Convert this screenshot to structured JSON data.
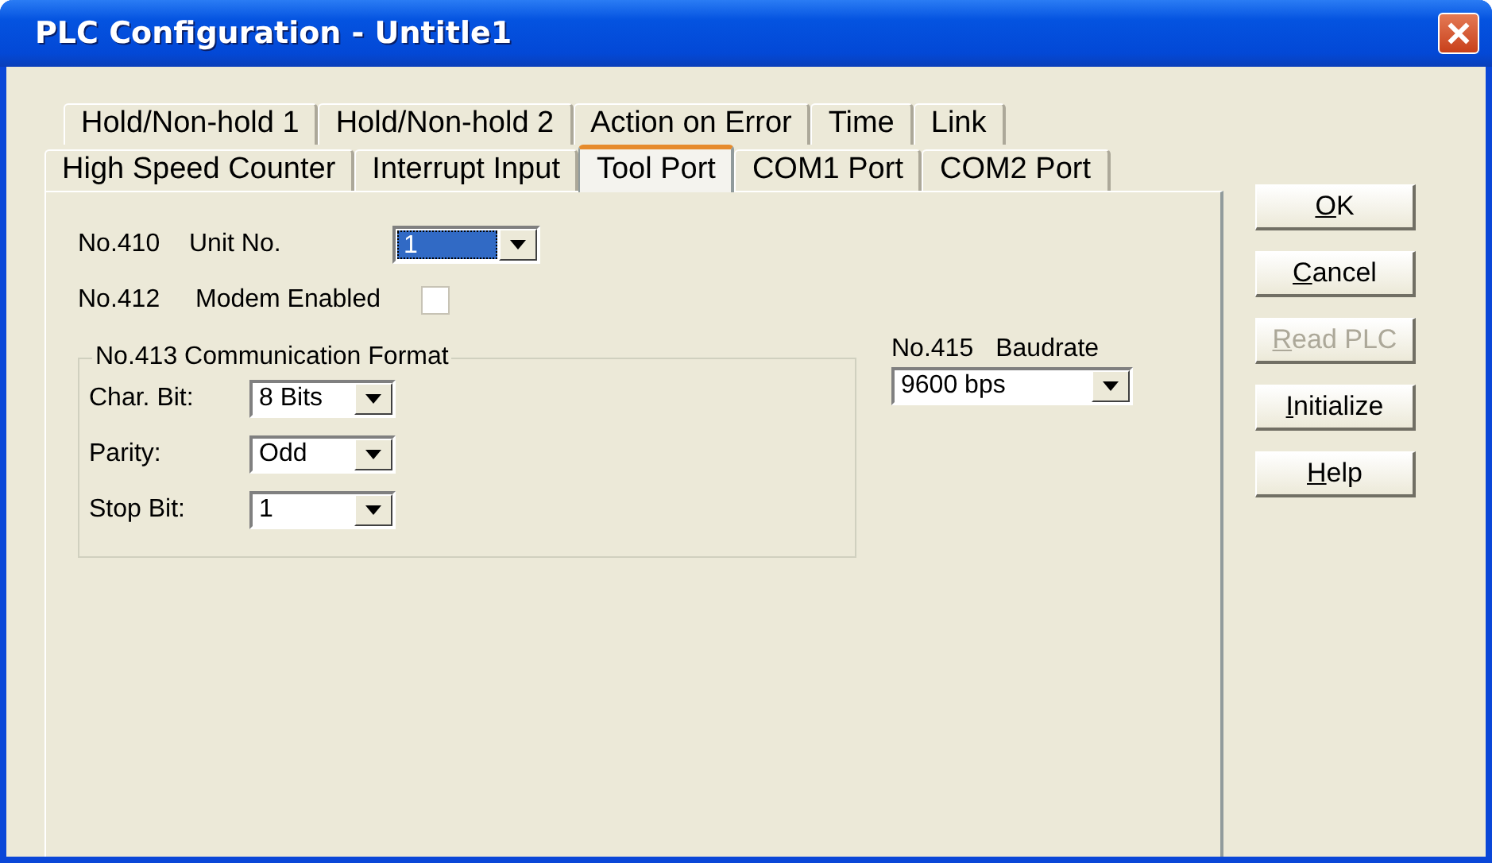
{
  "window": {
    "title": "PLC Configuration - Untitle1"
  },
  "tab_rows": [
    [
      {
        "label": "Hold/Non-hold 1",
        "selected": false
      },
      {
        "label": "Hold/Non-hold 2",
        "selected": false
      },
      {
        "label": "Action on Error",
        "selected": false
      },
      {
        "label": "Time",
        "selected": false
      },
      {
        "label": "Link",
        "selected": false
      }
    ],
    [
      {
        "label": "High Speed Counter",
        "selected": false
      },
      {
        "label": "Interrupt Input",
        "selected": false
      },
      {
        "label": "Tool Port",
        "selected": true
      },
      {
        "label": "COM1 Port",
        "selected": false
      },
      {
        "label": "COM2 Port",
        "selected": false
      }
    ]
  ],
  "tool_port": {
    "unit_no": {
      "code": "No.410",
      "label": "Unit No.",
      "value": "1",
      "focused": true
    },
    "modem": {
      "code": "No.412",
      "label": "Modem Enabled",
      "checked": false
    },
    "communication_format": {
      "title": "No.413 Communication Format",
      "fields": [
        {
          "label": "Char. Bit:",
          "value": "8 Bits"
        },
        {
          "label": "Parity:",
          "value": "Odd"
        },
        {
          "label": "Stop Bit:",
          "value": "1"
        }
      ]
    },
    "baudrate": {
      "code": "No.415",
      "label": "Baudrate",
      "value": "9600 bps"
    }
  },
  "buttons": [
    {
      "key": "O",
      "rest": "K",
      "disabled": false
    },
    {
      "key": "C",
      "rest": "ancel",
      "disabled": false
    },
    {
      "key": "R",
      "rest": "ead PLC",
      "disabled": true
    },
    {
      "key": "I",
      "rest": "nitialize",
      "disabled": false
    },
    {
      "key": "H",
      "rest": "elp",
      "disabled": false
    }
  ]
}
